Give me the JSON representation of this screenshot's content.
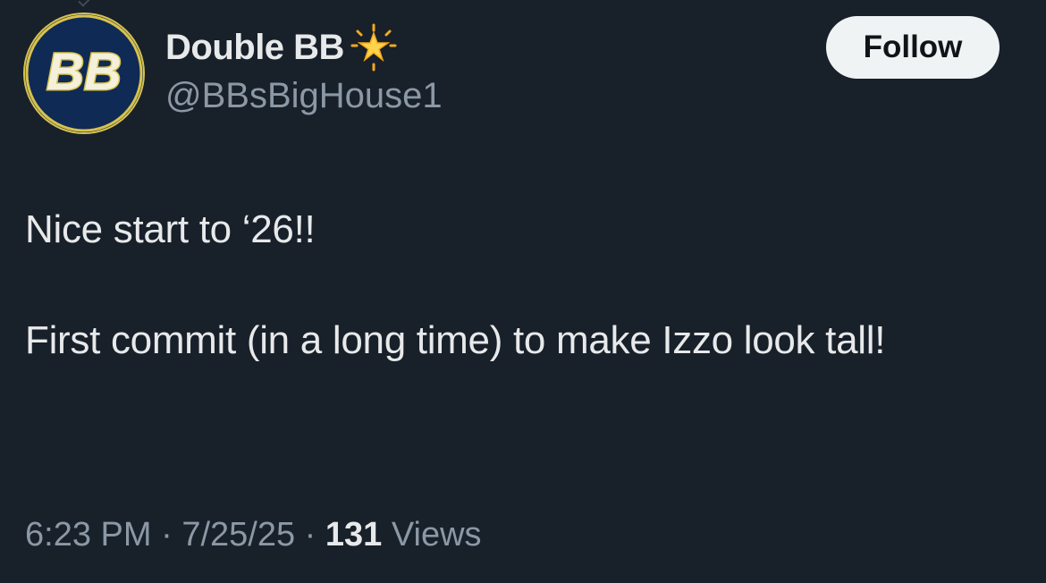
{
  "author": {
    "display_name": "Double BB",
    "handle": "@BBsBigHouse1",
    "avatar_text": "BB",
    "badge_icon": "glowing-star-icon"
  },
  "follow_button": {
    "label": "Follow"
  },
  "tweet": {
    "text": "Nice start to ‘26!!\n\nFirst commit (in a long time) to make Izzo look tall!"
  },
  "meta": {
    "time": "6:23 PM",
    "separator": "·",
    "date": "7/25/25",
    "views_count": "131",
    "views_label": "Views"
  },
  "colors": {
    "background": "#18202a",
    "primary_text": "#e7e9ea",
    "secondary_text": "#8b98a5",
    "follow_bg": "#eff3f4",
    "avatar_blue": "#0f2a55",
    "avatar_gold": "#d8c24c"
  }
}
